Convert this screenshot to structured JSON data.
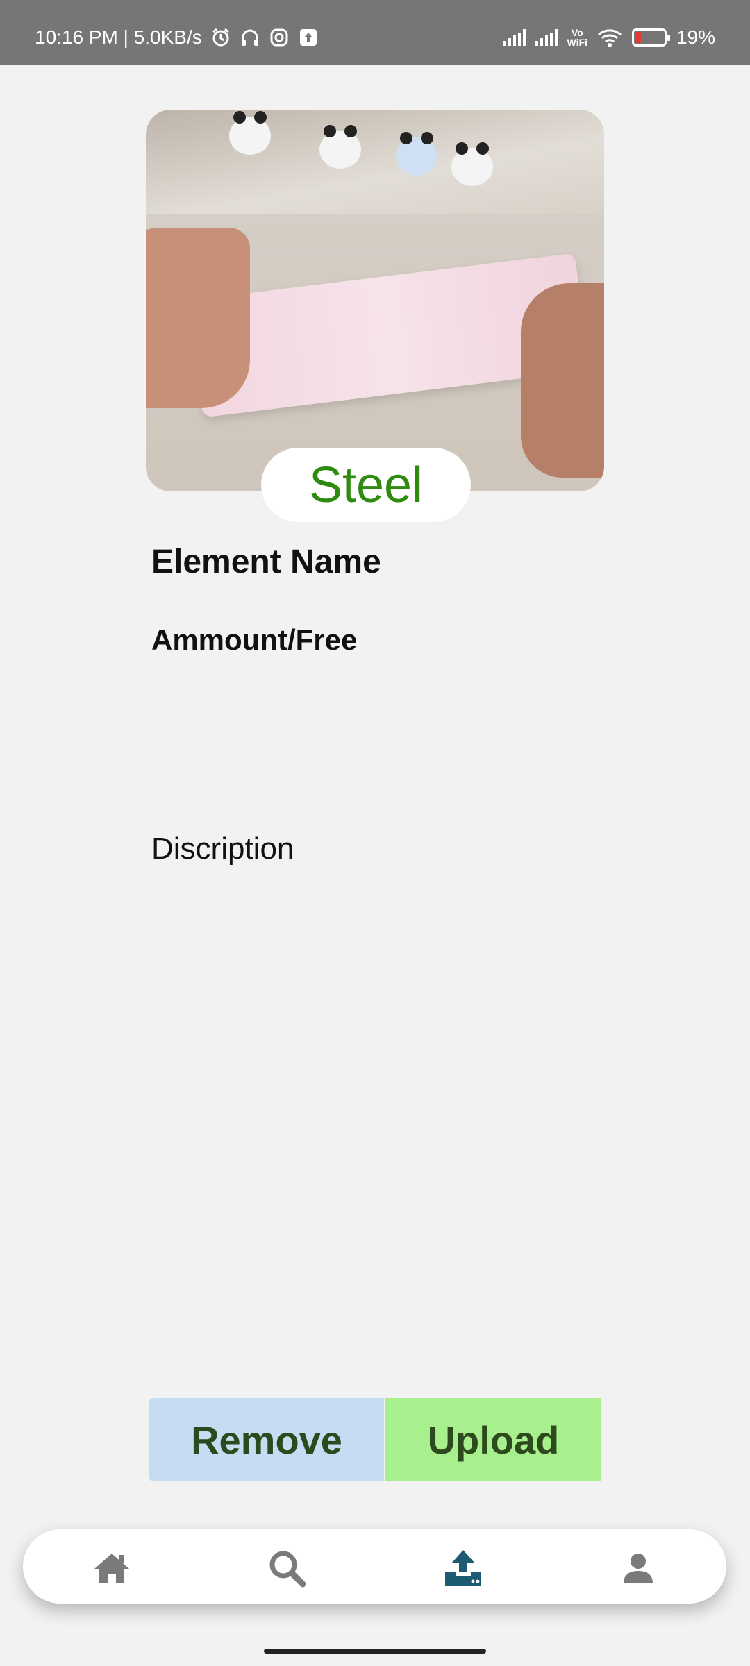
{
  "status_bar": {
    "time_speed": "10:16 PM | 5.0KB/s",
    "network_label": "Vo\nWiFi",
    "battery": "19%"
  },
  "product": {
    "material": "Steel",
    "element_name": "Element Name",
    "amount": "Ammount/Free",
    "description": "Discription"
  },
  "actions": {
    "remove_label": "Remove",
    "upload_label": "Upload"
  },
  "nav": {
    "items": [
      "home-icon",
      "search-icon",
      "upload-icon",
      "profile-icon"
    ],
    "active": "upload-icon",
    "active_color": "#1d5b73",
    "inactive_color": "#7a7a7a"
  },
  "colors": {
    "material_text": "#2e8b0f",
    "remove_bg": "#c6dcf2",
    "upload_bg": "#a8f08d",
    "button_text": "#2c4a1e"
  }
}
